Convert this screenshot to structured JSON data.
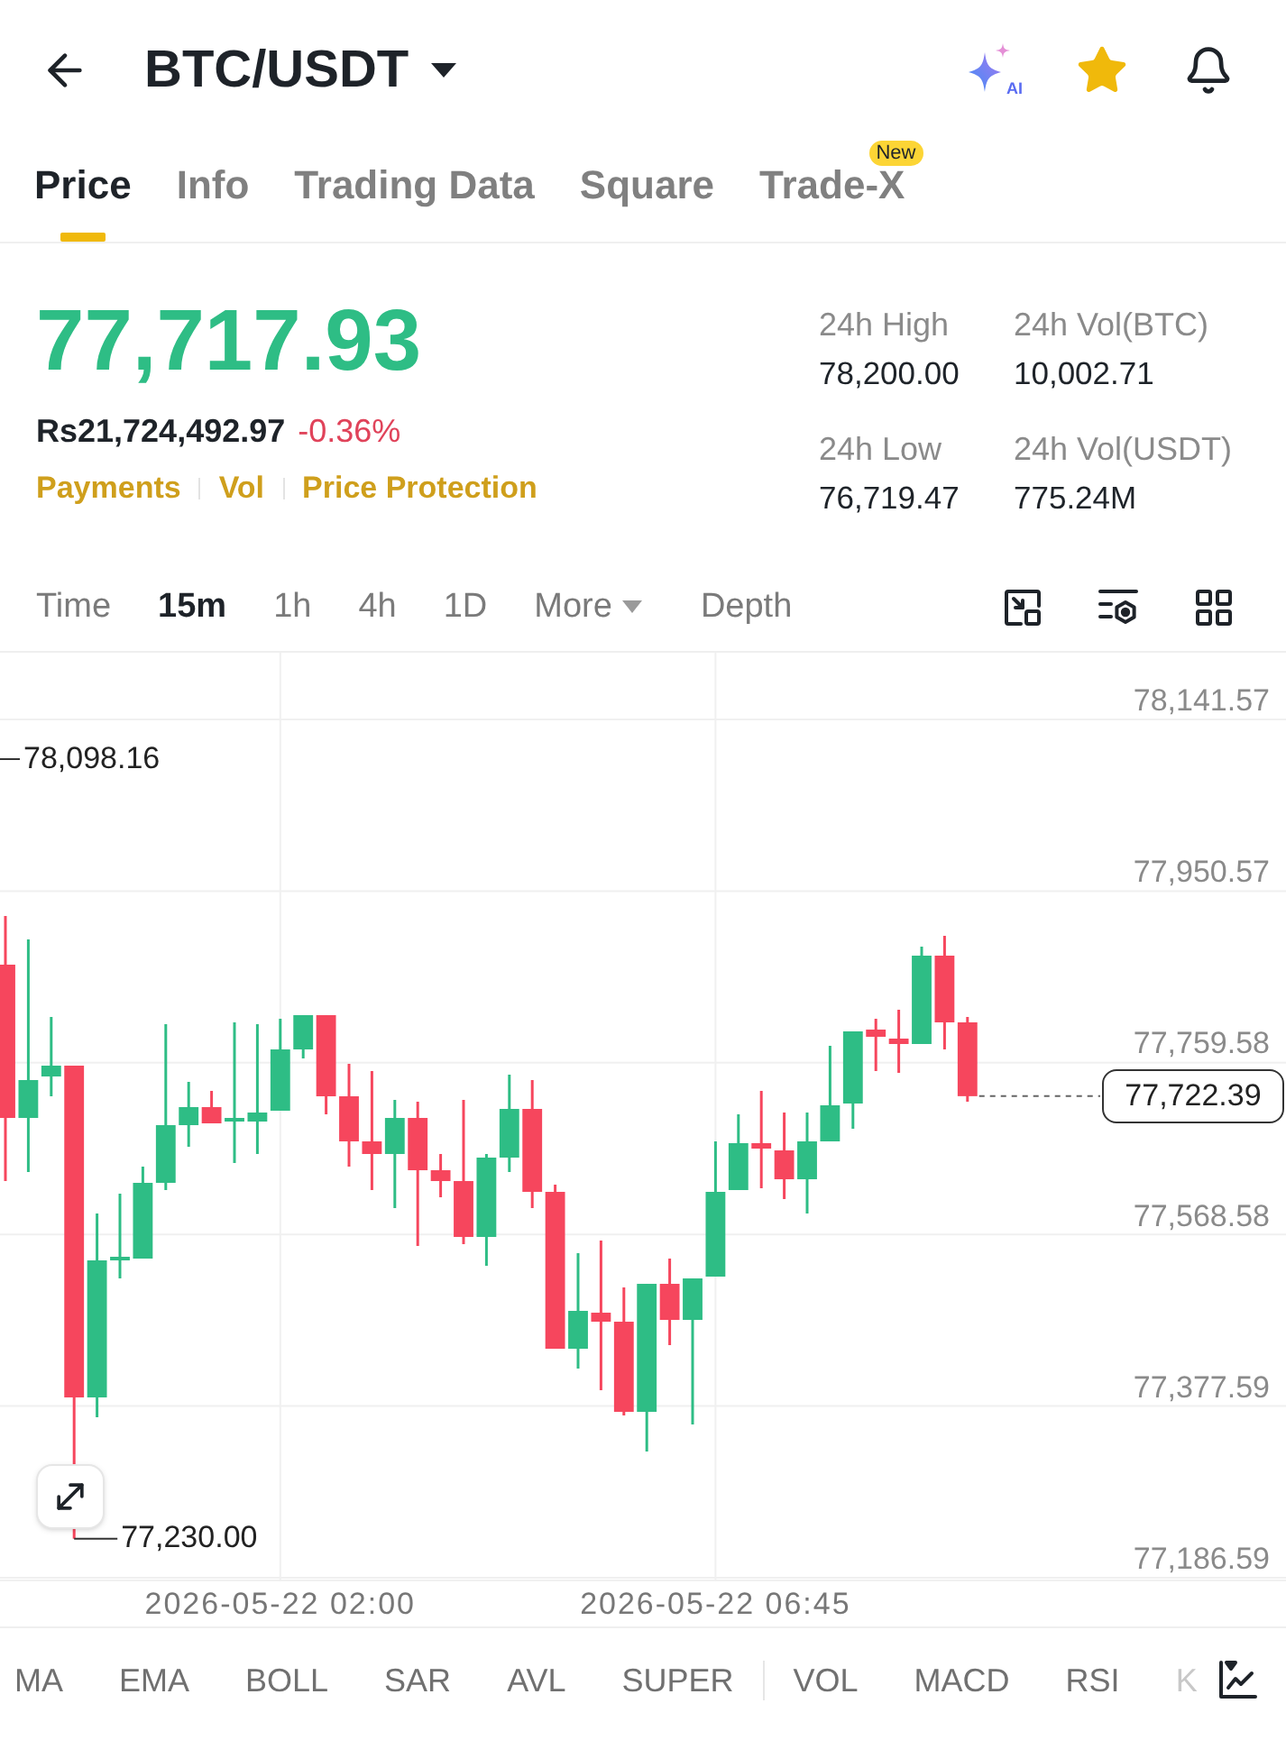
{
  "header": {
    "title": "BTC/USDT",
    "ai_label": "AI",
    "favorite": true
  },
  "tabs": [
    {
      "label": "Price",
      "selected": true
    },
    {
      "label": "Info",
      "selected": false
    },
    {
      "label": "Trading Data",
      "selected": false
    },
    {
      "label": "Square",
      "selected": false
    },
    {
      "label": "Trade-X",
      "selected": false,
      "badge": "New"
    }
  ],
  "ticker": {
    "last_price": "77,717.93",
    "price_up": true,
    "fiat_price": "Rs21,724,492.97",
    "change": "-0.36%",
    "change_up": false,
    "links": [
      "Payments",
      "Vol",
      "Price Protection"
    ]
  },
  "stats": [
    {
      "label": "24h High",
      "value": "78,200.00"
    },
    {
      "label": "24h Vol(BTC)",
      "value": "10,002.71"
    },
    {
      "label": "24h Low",
      "value": "76,719.47"
    },
    {
      "label": "24h Vol(USDT)",
      "value": "775.24M"
    }
  ],
  "intervals": [
    {
      "label": "Time",
      "kind": "interval",
      "selected": false
    },
    {
      "label": "15m",
      "kind": "interval",
      "selected": true
    },
    {
      "label": "1h",
      "kind": "interval",
      "selected": false
    },
    {
      "label": "4h",
      "kind": "interval",
      "selected": false
    },
    {
      "label": "1D",
      "kind": "interval",
      "selected": false
    },
    {
      "label": "More",
      "kind": "dropdown",
      "selected": false
    },
    {
      "label": "Depth",
      "kind": "view",
      "selected": false
    }
  ],
  "chart": {
    "chart_data": {
      "type": "candlestick",
      "grid": true,
      "categories": [
        null,
        null,
        null,
        null,
        null,
        null,
        null,
        null,
        null,
        null,
        null,
        null,
        "2026-05-22 02:00",
        null,
        null,
        null,
        null,
        null,
        null,
        null,
        null,
        null,
        null,
        null,
        null,
        null,
        null,
        null,
        null,
        null,
        null,
        "2026-05-22 06:45",
        null,
        null,
        null,
        null,
        null,
        null,
        null,
        null,
        null,
        null,
        null
      ],
      "ohlc": [
        [
          77868.71,
          77922.88,
          77627.95,
          77698.17
        ],
        [
          77698.17,
          77896.8,
          77637.98,
          77740.31
        ],
        [
          77744.32,
          77810.53,
          77722.25,
          77756.36
        ],
        [
          77756.36,
          77756.36,
          77230.0,
          77387.2
        ],
        [
          77387.2,
          77591.84,
          77365.13,
          77539.68
        ],
        [
          77539.68,
          77613.91,
          77519.61,
          77543.69
        ],
        [
          77541.68,
          77644.0,
          77541.68,
          77625.95
        ],
        [
          77625.95,
          77802.5,
          77617.92,
          77690.15
        ],
        [
          77690.15,
          77738.3,
          77666.07,
          77710.21
        ],
        [
          77710.21,
          77728.27,
          77692.16,
          77692.16
        ],
        [
          77694.16,
          77804.51,
          77648.02,
          77698.17
        ],
        [
          77694.16,
          77802.5,
          77658.05,
          77704.19
        ],
        [
          77706.2,
          77808.52,
          77706.2,
          77774.41
        ],
        [
          77774.41,
          77812.53,
          77764.38,
          77812.53
        ],
        [
          77812.53,
          77812.53,
          77702.19,
          77722.25
        ],
        [
          77722.25,
          77758.36,
          77644.0,
          77672.09
        ],
        [
          77672.09,
          77750.34,
          77617.92,
          77658.05
        ],
        [
          77658.05,
          77718.24,
          77597.86,
          77698.17
        ],
        [
          77698.17,
          77716.23,
          77555.73,
          77639.99
        ],
        [
          77639.99,
          77658.05,
          77609.9,
          77627.95
        ],
        [
          77627.95,
          77718.24,
          77557.73,
          77565.76
        ],
        [
          77565.76,
          77658.05,
          77533.66,
          77654.04
        ],
        [
          77654.04,
          77746.33,
          77637.98,
          77708.21
        ],
        [
          77708.21,
          77740.31,
          77597.86,
          77615.92
        ],
        [
          77615.92,
          77623.94,
          77441.37,
          77441.37
        ],
        [
          77441.37,
          77547.7,
          77419.3,
          77483.5
        ],
        [
          77481.49,
          77561.75,
          77395.22,
          77471.46
        ],
        [
          77471.46,
          77509.58,
          77367.13,
          77371.15
        ],
        [
          77371.15,
          77513.59,
          77327.01,
          77513.59
        ],
        [
          77513.59,
          77541.68,
          77445.38,
          77473.47
        ],
        [
          77473.47,
          77519.61,
          77357.1,
          77519.61
        ],
        [
          77521.62,
          77672.09,
          77521.62,
          77615.92
        ],
        [
          77617.92,
          77702.19,
          77617.92,
          77670.09
        ],
        [
          77670.09,
          77728.27,
          77619.93,
          77664.07
        ],
        [
          77662.06,
          77704.19,
          77607.89,
          77629.96
        ],
        [
          77629.96,
          77704.19,
          77591.84,
          77672.09
        ],
        [
          77672.09,
          77778.43,
          77672.09,
          77712.22
        ],
        [
          77714.22,
          77794.48,
          77686.14,
          77794.48
        ],
        [
          77796.48,
          77808.52,
          77750.34,
          77788.46
        ],
        [
          77786.45,
          77818.55,
          77748.33,
          77780.43
        ],
        [
          77780.43,
          77888.77,
          77780.43,
          77878.74
        ],
        [
          77878.74,
          77900.81,
          77774.41,
          77804.51
        ],
        [
          77804.51,
          77810.53,
          77716.23,
          77722.39
        ]
      ],
      "ylim": [
        77182.58,
        78215.8
      ],
      "yticks": [
        {
          "value": 78141.57,
          "label": "78,141.57"
        },
        {
          "value": 77950.57,
          "label": "77,950.57"
        },
        {
          "value": 77759.58,
          "label": "77,759.58"
        },
        {
          "value": 77568.58,
          "label": "77,568.58"
        },
        {
          "value": 77377.59,
          "label": "77,377.59"
        },
        {
          "value": 77186.59,
          "label": "77,186.59"
        }
      ],
      "annotations": [
        "78,098.16",
        "77,230.00"
      ],
      "ref_lines": [
        {
          "axis": "y",
          "value": 77722.39,
          "label": "77,722.39"
        }
      ]
    }
  },
  "indicators": {
    "main": [
      "MA",
      "EMA",
      "BOLL",
      "SAR",
      "AVL",
      "SUPER"
    ],
    "sub": [
      "VOL",
      "MACD",
      "RSI",
      "K"
    ]
  }
}
